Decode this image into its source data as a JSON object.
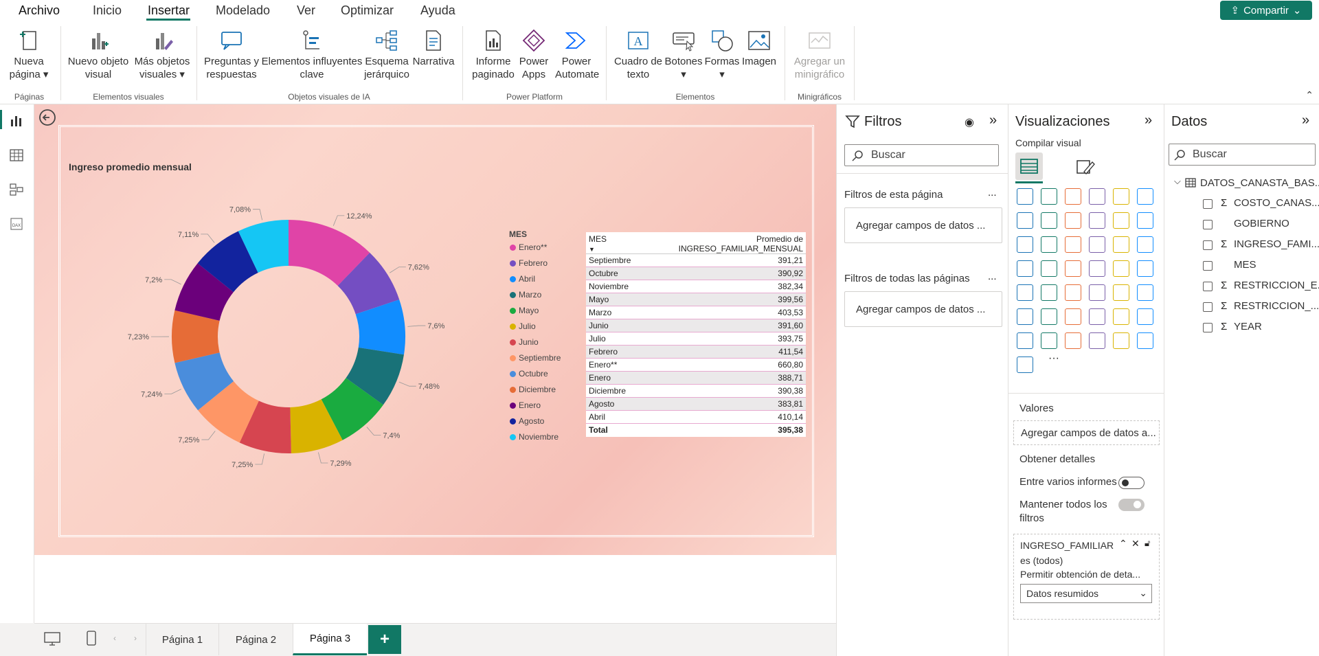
{
  "menu": {
    "items": [
      "Archivo",
      "Inicio",
      "Insertar",
      "Modelado",
      "Ver",
      "Optimizar",
      "Ayuda"
    ],
    "active": "Insertar",
    "share_label": "Compartir"
  },
  "ribbon": {
    "buttons": [
      {
        "l1": "Nueva",
        "l2": "página ▾"
      },
      {
        "l1": "Nuevo objeto",
        "l2": "visual"
      },
      {
        "l1": "Más objetos",
        "l2": "visuales ▾"
      },
      {
        "l1": "Preguntas y",
        "l2": "respuestas"
      },
      {
        "l1": "Elementos influyentes",
        "l2": "clave"
      },
      {
        "l1": "Esquema",
        "l2": "jerárquico"
      },
      {
        "l1": "Narrativa",
        "l2": ""
      },
      {
        "l1": "Informe",
        "l2": "paginado"
      },
      {
        "l1": "Power",
        "l2": "Apps"
      },
      {
        "l1": "Power",
        "l2": "Automate"
      },
      {
        "l1": "Cuadro de",
        "l2": "texto"
      },
      {
        "l1": "Botones",
        "l2": "▾"
      },
      {
        "l1": "Formas",
        "l2": "▾"
      },
      {
        "l1": "Imagen",
        "l2": ""
      },
      {
        "l1": "Agregar un",
        "l2": "minigráfico"
      }
    ],
    "groups": [
      "Páginas",
      "Elementos visuales",
      "Objetos visuales de IA",
      "Power Platform",
      "Elementos",
      "Minigráficos"
    ]
  },
  "report": {
    "chart_title": "Ingreso promedio mensual",
    "legend_title": "MES",
    "table_headers": [
      "MES",
      "Promedio de INGRESO_FAMILIAR_MENSUAL"
    ],
    "table_rows": [
      [
        "Septiembre",
        "391,21"
      ],
      [
        "Octubre",
        "390,92"
      ],
      [
        "Noviembre",
        "382,34"
      ],
      [
        "Mayo",
        "399,56"
      ],
      [
        "Marzo",
        "403,53"
      ],
      [
        "Junio",
        "391,60"
      ],
      [
        "Julio",
        "393,75"
      ],
      [
        "Febrero",
        "411,54"
      ],
      [
        "Enero**",
        "660,80"
      ],
      [
        "Enero",
        "388,71"
      ],
      [
        "Diciembre",
        "390,38"
      ],
      [
        "Agosto",
        "383,81"
      ],
      [
        "Abril",
        "410,14"
      ]
    ],
    "table_total": [
      "Total",
      "395,38"
    ]
  },
  "chart_data": {
    "type": "pie",
    "title": "Ingreso promedio mensual",
    "legend_title": "MES",
    "categories": [
      "Enero**",
      "Febrero",
      "Abril",
      "Marzo",
      "Mayo",
      "Julio",
      "Junio",
      "Septiembre",
      "Octubre",
      "Diciembre",
      "Enero",
      "Agosto",
      "Noviembre"
    ],
    "values": [
      12.24,
      7.62,
      7.6,
      7.48,
      7.4,
      7.29,
      7.25,
      7.25,
      7.24,
      7.23,
      7.2,
      7.11,
      7.08
    ],
    "labels": [
      "12,24%",
      "7,62%",
      "7,6%",
      "7,48%",
      "7,4%",
      "7,29%",
      "7,25%",
      "7,25%",
      "7,24%",
      "7,23%",
      "7,2%",
      "7,11%",
      "7,08%"
    ],
    "colors": [
      "#e044a7",
      "#744ec2",
      "#118dff",
      "#197278",
      "#1aab40",
      "#d9b300",
      "#d64550",
      "#fe9666",
      "#4a8ddc",
      "#e66c37",
      "#6b007b",
      "#12239e",
      "#15c6f4"
    ],
    "donut": true,
    "legend_position": "right"
  },
  "pages": {
    "tabs": [
      "Página 1",
      "Página 2",
      "Página 3"
    ],
    "active": "Página 3",
    "add_label": "+"
  },
  "filters": {
    "title": "Filtros",
    "search_placeholder": "Buscar",
    "section1": "Filtros de esta página",
    "section2": "Filtros de todas las páginas",
    "add_fields": "Agregar campos de datos ...",
    "more": "..."
  },
  "viz": {
    "title": "Visualizaciones",
    "build_label": "Compilar visual",
    "values_label": "Valores",
    "values_add": "Agregar campos de datos a...",
    "drill_label": "Obtener detalles",
    "cross_report": "Entre varios informes",
    "keep_filters_1": "Mantener todos los",
    "keep_filters_2": "filtros",
    "filter_card_field": "INGRESO_FAMILIAR",
    "filter_card_is": "es (todos)",
    "filter_card_allow": "Permitir obtención de deta...",
    "filter_card_select": "Datos resumidos",
    "more_icon": "···"
  },
  "data": {
    "title": "Datos",
    "search_placeholder": "Buscar",
    "table_name": "DATOS_CANASTA_BAS...",
    "fields": [
      {
        "name": "COSTO_CANAS...",
        "sigma": true
      },
      {
        "name": "GOBIERNO",
        "sigma": false
      },
      {
        "name": "INGRESO_FAMI...",
        "sigma": true
      },
      {
        "name": "MES",
        "sigma": false
      },
      {
        "name": "RESTRICCION_E...",
        "sigma": true
      },
      {
        "name": "RESTRICCION_...",
        "sigma": true
      },
      {
        "name": "YEAR",
        "sigma": true
      }
    ]
  }
}
